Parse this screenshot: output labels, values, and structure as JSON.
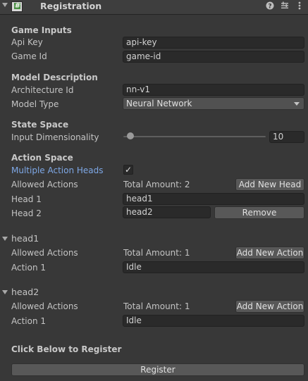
{
  "header": {
    "title": "Registration",
    "script_icon_glyph": "#"
  },
  "game_inputs": {
    "title": "Game Inputs",
    "api_key_label": "Api Key",
    "api_key_value": "api-key",
    "game_id_label": "Game Id",
    "game_id_value": "game-id"
  },
  "model_description": {
    "title": "Model Description",
    "architecture_label": "Architecture Id",
    "architecture_value": "nn-v1",
    "model_type_label": "Model Type",
    "model_type_value": "Neural Network"
  },
  "state_space": {
    "title": "State Space",
    "input_dim_label": "Input Dimensionality",
    "input_dim_value": "10",
    "slider_fraction": 0.05
  },
  "action_space": {
    "title": "Action Space",
    "multiple_heads_label": "Multiple Action Heads",
    "multiple_heads_checked": true,
    "checkmark": "✓",
    "allowed_actions_label": "Allowed Actions",
    "total_amount": "Total Amount: 2",
    "add_head_label": "Add New Head",
    "heads": [
      {
        "label": "Head 1",
        "value": "head1"
      },
      {
        "label": "Head 2",
        "value": "head2",
        "remove_label": "Remove"
      }
    ]
  },
  "head_sections": [
    {
      "title": "head1",
      "allowed_actions_label": "Allowed Actions",
      "total_amount": "Total Amount: 1",
      "add_action_label": "Add New Action",
      "action_label": "Action 1",
      "action_value": "Idle"
    },
    {
      "title": "head2",
      "allowed_actions_label": "Allowed Actions",
      "total_amount": "Total Amount: 1",
      "add_action_label": "Add New Action",
      "action_label": "Action 1",
      "action_value": "Idle"
    }
  ],
  "register": {
    "prompt": "Click Below to Register",
    "button_label": "Register"
  },
  "colors": {
    "background": "#383838",
    "field": "#2a2a2a",
    "button": "#585858",
    "link_blue": "#7ea8e6",
    "script_check": "#4a8f43"
  }
}
